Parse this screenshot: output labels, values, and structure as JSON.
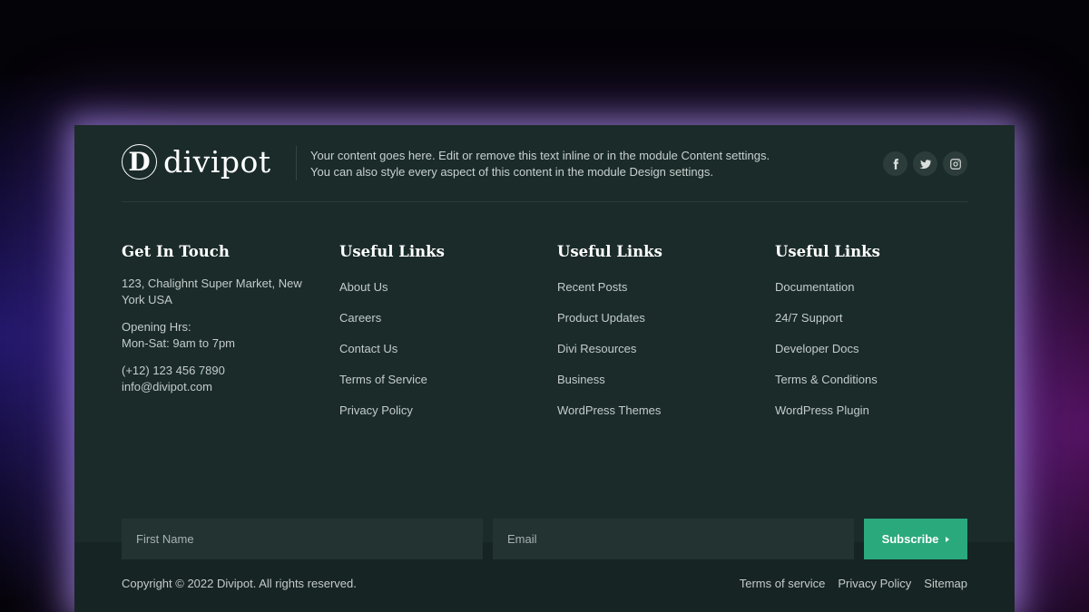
{
  "brand": {
    "logo_letter": "D",
    "name": "divipot"
  },
  "header": {
    "text_line1": "Your content goes here. Edit or remove this text inline or in the module Content settings.",
    "text_line2": "You can also style every aspect of this content in the module Design settings."
  },
  "social": [
    {
      "icon": "facebook-icon"
    },
    {
      "icon": "twitter-icon"
    },
    {
      "icon": "instagram-icon"
    }
  ],
  "contact": {
    "title": "Get In Touch",
    "address": "123, Chalighnt Super Market, New York USA",
    "hours_label": "Opening Hrs:",
    "hours": "Mon-Sat: 9am to 7pm",
    "phone": "(+12) 123 456 7890",
    "email": "info@divipot.com"
  },
  "link_columns": [
    {
      "title": "Useful Links",
      "links": [
        "About Us",
        "Careers",
        "Contact Us",
        "Terms of Service",
        "Privacy Policy"
      ]
    },
    {
      "title": "Useful Links",
      "links": [
        "Recent Posts",
        "Product Updates",
        "Divi Resources",
        "Business",
        "WordPress Themes"
      ]
    },
    {
      "title": "Useful Links",
      "links": [
        "Documentation",
        "24/7 Support",
        "Developer Docs",
        "Terms & Conditions",
        "WordPress Plugin"
      ]
    }
  ],
  "subscribe": {
    "first_name_placeholder": "First Name",
    "email_placeholder": "Email",
    "button_label": "Subscribe"
  },
  "bottom": {
    "copyright": "Copyright © 2022 Divipot. All rights reserved.",
    "links": [
      "Terms of service",
      "Privacy Policy",
      "Sitemap"
    ]
  },
  "colors": {
    "footer_bg": "#1a2b2a",
    "accent": "#2aa97d",
    "text": "#c4ccca",
    "heading": "#ffffff"
  }
}
